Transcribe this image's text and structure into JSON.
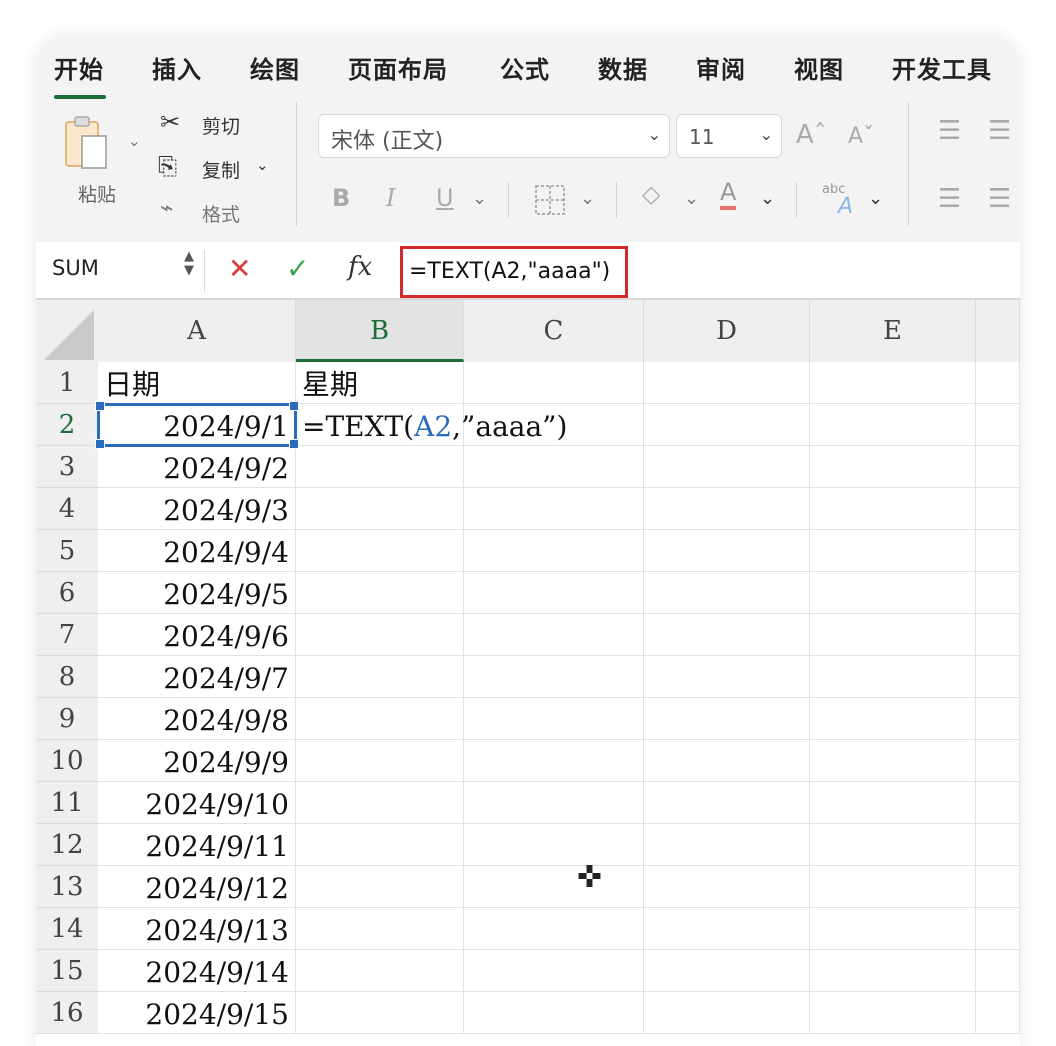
{
  "ribbon": {
    "tabs": [
      "开始",
      "插入",
      "绘图",
      "页面布局",
      "公式",
      "数据",
      "审阅",
      "视图",
      "开发工具"
    ],
    "clipboard": {
      "paste": "粘贴",
      "cut": "剪切",
      "copy": "复制",
      "format": "格式"
    },
    "font_name": "宋体 (正文)",
    "font_size": "11",
    "grow_font": "Aˆ",
    "shrink_font": "Aˇ",
    "bold": "B",
    "italic": "I",
    "underline": "U",
    "font_color_letter": "A",
    "text_effect_label": "abc",
    "accent_color": "#1e6b3a"
  },
  "formula_bar": {
    "name_box": "SUM",
    "cancel": "✕",
    "enter": "✓",
    "fx": "fx",
    "formula": "=TEXT(A2,\"aaaa\")"
  },
  "sheet": {
    "columns": [
      "A",
      "B",
      "C",
      "D",
      "E"
    ],
    "selected_column": "B",
    "active_row": "2",
    "rows": [
      {
        "n": "1",
        "a": "日期",
        "b": "星期"
      },
      {
        "n": "2",
        "a": "2024/9/1",
        "b_pre": "=TEXT(",
        "b_ref": "A2",
        "b_post": ",”aaaa”)"
      },
      {
        "n": "3",
        "a": "2024/9/2"
      },
      {
        "n": "4",
        "a": "2024/9/3"
      },
      {
        "n": "5",
        "a": "2024/9/4"
      },
      {
        "n": "6",
        "a": "2024/9/5"
      },
      {
        "n": "7",
        "a": "2024/9/6"
      },
      {
        "n": "8",
        "a": "2024/9/7"
      },
      {
        "n": "9",
        "a": "2024/9/8"
      },
      {
        "n": "10",
        "a": "2024/9/9"
      },
      {
        "n": "11",
        "a": "2024/9/10"
      },
      {
        "n": "12",
        "a": "2024/9/11"
      },
      {
        "n": "13",
        "a": "2024/9/12"
      },
      {
        "n": "14",
        "a": "2024/9/13"
      },
      {
        "n": "15",
        "a": "2024/9/14"
      },
      {
        "n": "16",
        "a": "2024/9/15"
      }
    ]
  }
}
